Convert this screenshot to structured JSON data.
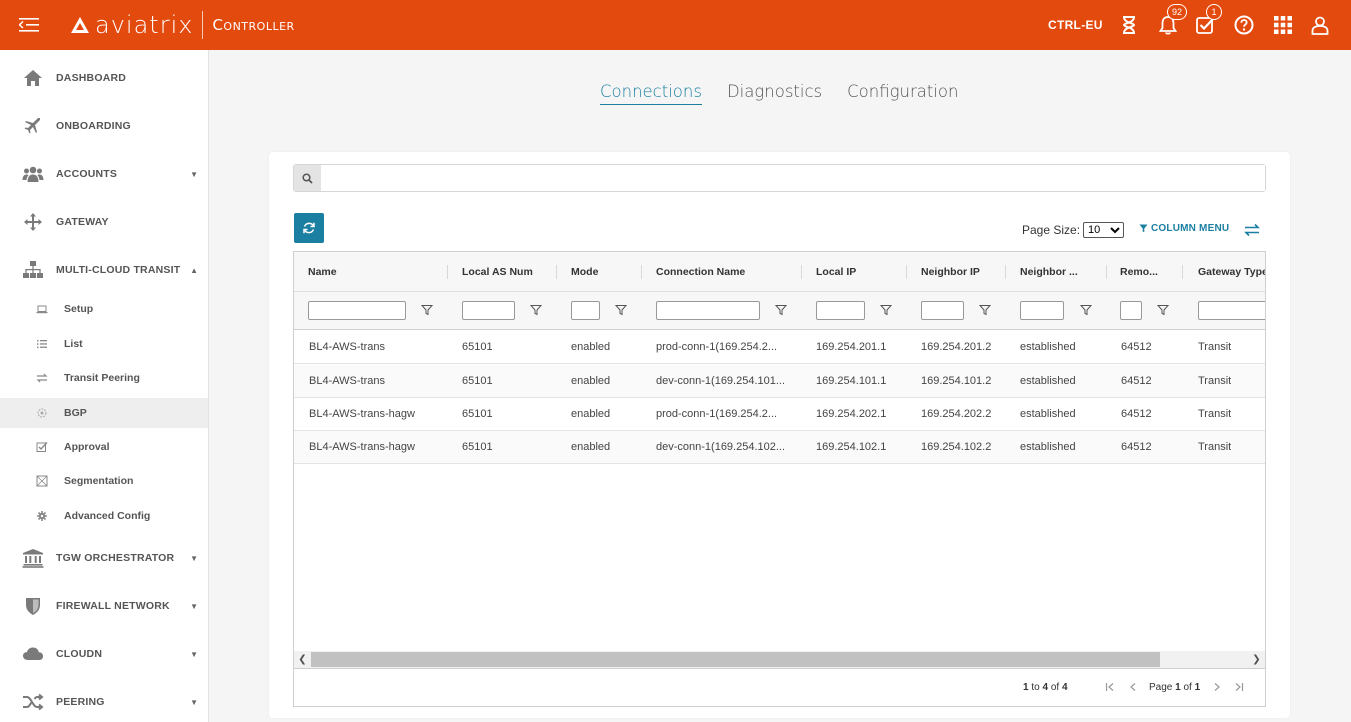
{
  "header": {
    "logo_text": "aviatrix",
    "logo_sub": "Controller",
    "controller_name": "CTRL-EU",
    "notifications_count": "92",
    "tasks_count": "1",
    "brand_color": "#e34a0e"
  },
  "sidebar": {
    "items": [
      {
        "label": "DASHBOARD",
        "icon": "home-icon"
      },
      {
        "label": "ONBOARDING",
        "icon": "plane-icon"
      },
      {
        "label": "ACCOUNTS",
        "icon": "users-icon"
      },
      {
        "label": "GATEWAY",
        "icon": "move-icon"
      },
      {
        "label": "MULTI-CLOUD TRANSIT",
        "icon": "sitemap-icon"
      },
      {
        "label": "TGW ORCHESTRATOR",
        "icon": "bank-icon"
      },
      {
        "label": "FIREWALL NETWORK",
        "icon": "shield-icon"
      },
      {
        "label": "CLOUDN",
        "icon": "cloud-icon"
      },
      {
        "label": "PEERING",
        "icon": "shuffle-icon"
      }
    ],
    "transit_subitems": [
      {
        "label": "Setup"
      },
      {
        "label": "List"
      },
      {
        "label": "Transit Peering"
      },
      {
        "label": "BGP"
      },
      {
        "label": "Approval"
      },
      {
        "label": "Segmentation"
      },
      {
        "label": "Advanced Config"
      }
    ]
  },
  "tabs": [
    {
      "label": "Connections",
      "active": true
    },
    {
      "label": "Diagnostics"
    },
    {
      "label": "Configuration"
    }
  ],
  "search": {
    "placeholder": "",
    "value": ""
  },
  "toolbar": {
    "page_size_label": "Page Size:",
    "page_size_value": "10",
    "column_menu_label": "COLUMN MENU"
  },
  "table": {
    "columns": [
      "Name",
      "Local AS Num",
      "Mode",
      "Connection Name",
      "Local IP",
      "Neighbor IP",
      "Neighbor ...",
      "Remo...",
      "Gateway Type"
    ],
    "rows": [
      [
        "BL4-AWS-trans",
        "65101",
        "enabled",
        "prod-conn-1(169.254.2...",
        "169.254.201.1",
        "169.254.201.2",
        "established",
        "64512",
        "Transit"
      ],
      [
        "BL4-AWS-trans",
        "65101",
        "enabled",
        "dev-conn-1(169.254.101...",
        "169.254.101.1",
        "169.254.101.2",
        "established",
        "64512",
        "Transit"
      ],
      [
        "BL4-AWS-trans-hagw",
        "65101",
        "enabled",
        "prod-conn-1(169.254.2...",
        "169.254.202.1",
        "169.254.202.2",
        "established",
        "64512",
        "Transit"
      ],
      [
        "BL4-AWS-trans-hagw",
        "65101",
        "enabled",
        "dev-conn-1(169.254.102...",
        "169.254.102.1",
        "169.254.102.2",
        "established",
        "64512",
        "Transit"
      ]
    ]
  },
  "pager": {
    "from": "1",
    "to_word": "to",
    "to": "4",
    "of_word": "of",
    "total": "4",
    "page_word": "Page",
    "page": "1",
    "page_of_word": "of",
    "pages": "1"
  }
}
